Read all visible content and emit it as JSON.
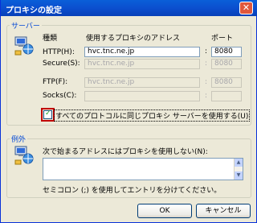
{
  "window": {
    "title": "プロキシの設定",
    "close_glyph": "✕"
  },
  "servers": {
    "group_label": "サーバー",
    "type_header": "種類",
    "address_header": "使用するプロキシのアドレス",
    "port_header": "ポート",
    "rows": [
      {
        "label": "HTTP(H):",
        "address": "hvc.tnc.ne.jp",
        "port": "8080",
        "enabled": true
      },
      {
        "label": "Secure(S):",
        "address": "hvc.tnc.ne.jp",
        "port": "8080",
        "enabled": false
      },
      {
        "label": "FTP(F):",
        "address": "hvc.tnc.ne.jp",
        "port": "8080",
        "enabled": false
      },
      {
        "label": "Socks(C):",
        "address": "",
        "port": "",
        "enabled": false
      }
    ],
    "same_proxy_label": "すべてのプロトコルに同じプロキシ サーバーを使用する(U)",
    "same_proxy_checked": true
  },
  "exceptions": {
    "group_label": "例外",
    "prompt": "次で始まるアドレスにはプロキシを使用しない(N):",
    "value": "",
    "note": "セミコロン (;) を使用してエントリを分けてください。"
  },
  "buttons": {
    "ok": "OK",
    "cancel": "キャンセル"
  }
}
